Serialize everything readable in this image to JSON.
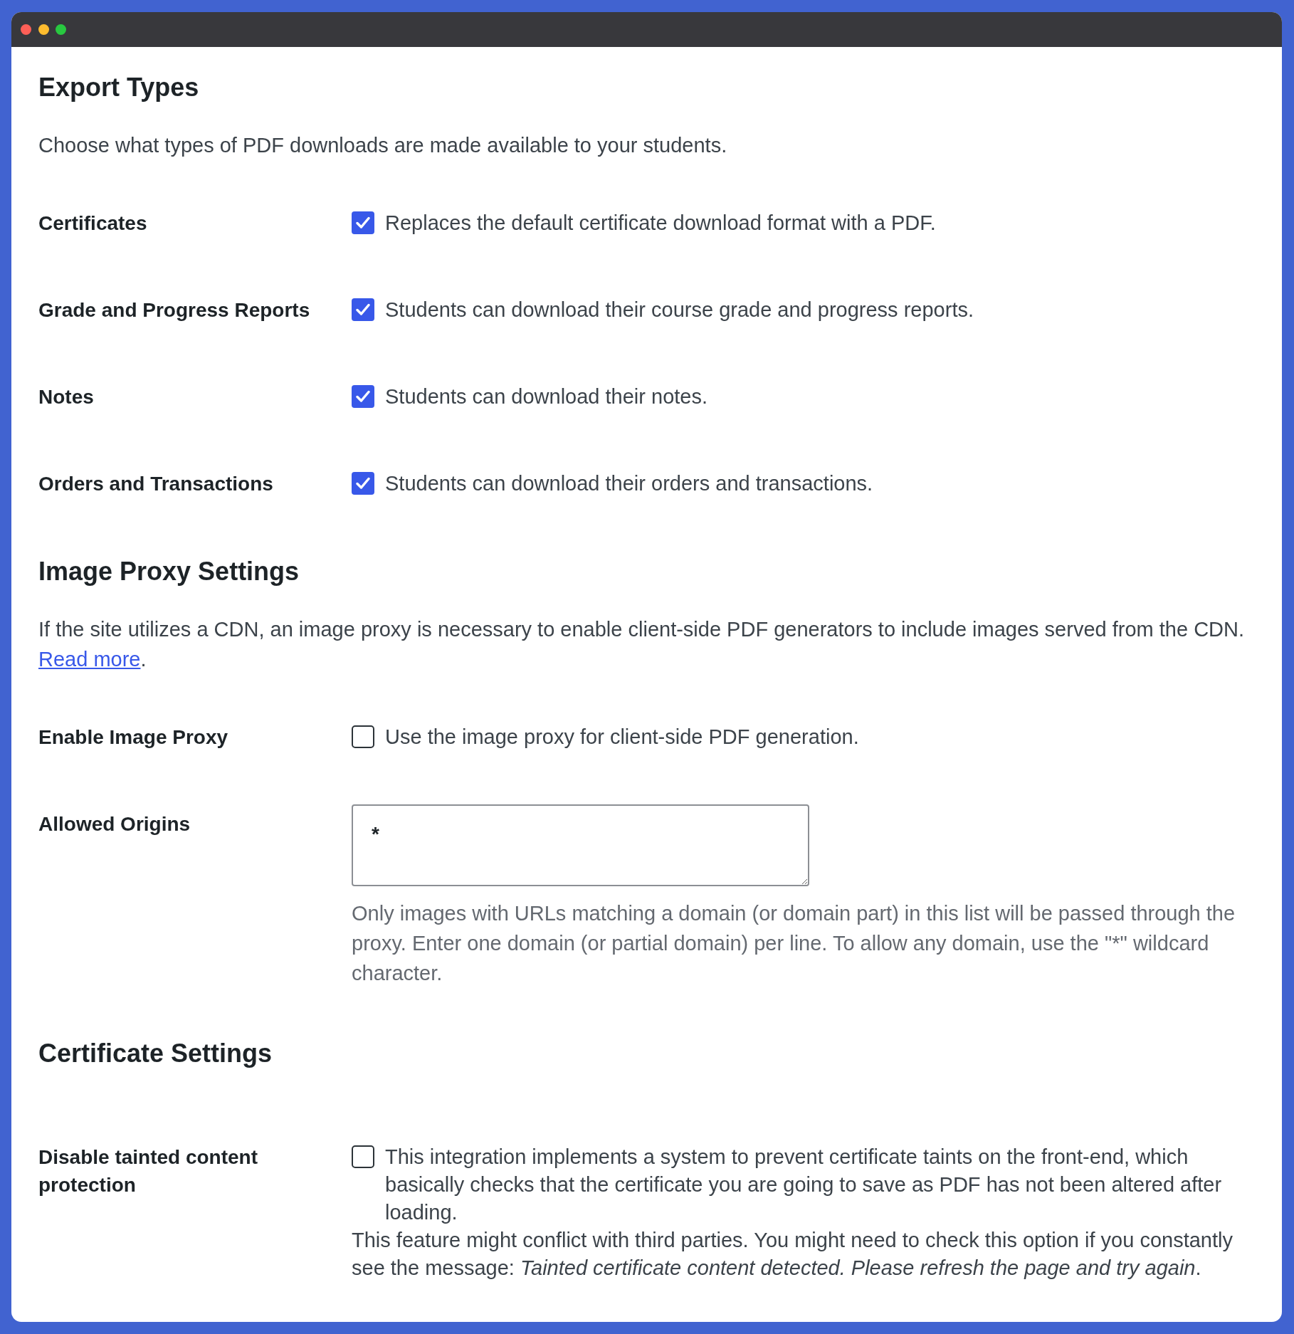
{
  "sections": [
    {
      "title": "Export Types",
      "description": "Choose what types of PDF downloads are made available to your students.",
      "fields": [
        {
          "kind": "checkbox",
          "label": "Certificates",
          "checked": true,
          "description": "Replaces the default certificate download format with a PDF."
        },
        {
          "kind": "checkbox",
          "label": "Grade and Progress Reports",
          "checked": true,
          "description": "Students can download their course grade and progress reports."
        },
        {
          "kind": "checkbox",
          "label": "Notes",
          "checked": true,
          "description": "Students can download their notes."
        },
        {
          "kind": "checkbox",
          "label": "Orders and Transactions",
          "checked": true,
          "description": "Students can download their orders and transactions."
        }
      ]
    },
    {
      "title": "Image Proxy Settings",
      "description": "If the site utilizes a CDN, an image proxy is necessary to enable client-side PDF generators to include images served from the CDN.",
      "link": {
        "text": "Read more",
        "after": "."
      },
      "fields": [
        {
          "kind": "checkbox",
          "label": "Enable Image Proxy",
          "checked": false,
          "description": "Use the image proxy for client-side PDF generation."
        },
        {
          "kind": "textarea",
          "label": "Allowed Origins",
          "value": "*",
          "help": "Only images with URLs matching a domain (or domain part) in this list will be passed through the proxy. Enter one domain (or partial domain) per line. To allow any domain, use the \"*\" wildcard character."
        }
      ]
    },
    {
      "title": "Certificate Settings",
      "fields": [
        {
          "kind": "checkbox",
          "label": "Disable tainted content protection",
          "checked": false,
          "description": "This integration implements a system to prevent certificate taints on the front-end, which basically checks that the certificate you are going to save as PDF has not been altered after loading.",
          "note": "This feature might conflict with third parties. You might need to check this option if you constantly see the message: *Tainted certificate content detected. Please refresh the page and try again*."
        }
      ]
    }
  ]
}
